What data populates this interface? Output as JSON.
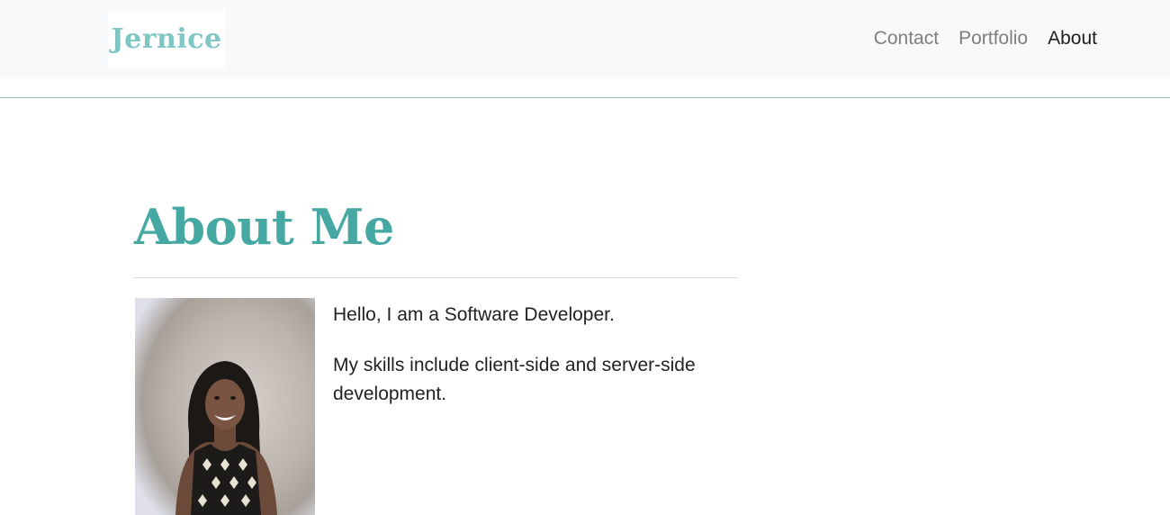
{
  "navbar": {
    "brand": "Jernice",
    "links": [
      {
        "label": "Contact",
        "active": false
      },
      {
        "label": "Portfolio",
        "active": false
      },
      {
        "label": "About",
        "active": true
      }
    ]
  },
  "main": {
    "title": "About Me",
    "paragraphs": [
      "Hello, I am a Software Developer.",
      "My skills include client-side and server-side development."
    ]
  },
  "colors": {
    "brand": "#7fc6c4",
    "title": "#46a8a2",
    "navbar_bg": "#f8f9fa",
    "nav_link": "#7f7f7f",
    "nav_active": "#1f1f1f"
  }
}
